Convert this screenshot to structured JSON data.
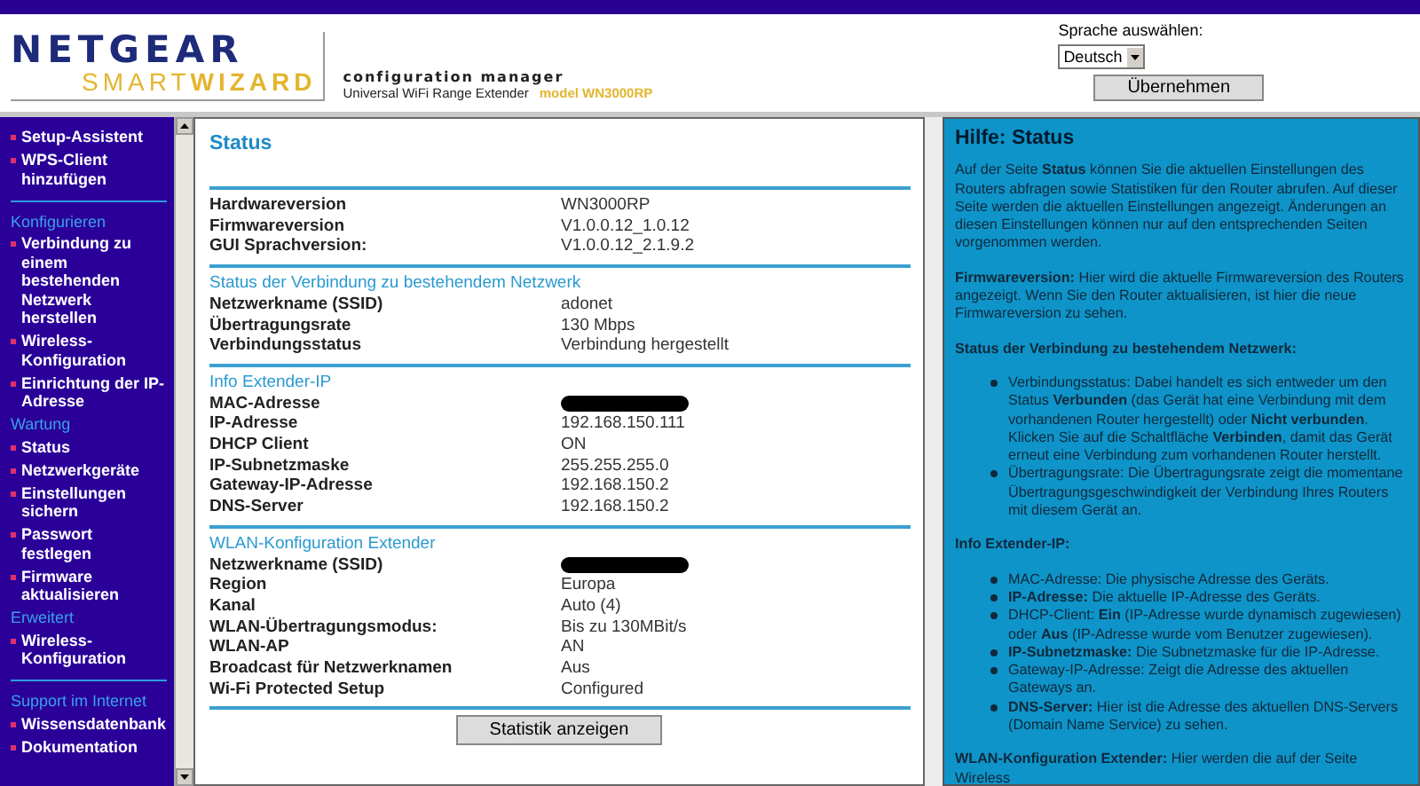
{
  "header": {
    "brand": "NETGEAR",
    "product_light": "SMART",
    "product_bold": "WIZARD",
    "tagline": "configuration manager",
    "product": "Universal WiFi Range Extender",
    "model": "model WN3000RP",
    "language_label": "Sprache auswählen:",
    "language_value": "Deutsch",
    "apply_button": "Übernehmen"
  },
  "sidebar": {
    "items": [
      {
        "kind": "link",
        "label": "Setup-Assistent"
      },
      {
        "kind": "link",
        "label": "WPS-Client hinzufügen"
      },
      {
        "kind": "divider"
      },
      {
        "kind": "heading",
        "label": "Konfigurieren"
      },
      {
        "kind": "link",
        "label": "Verbindung zu einem bestehenden Netzwerk herstellen"
      },
      {
        "kind": "link",
        "label": "Wireless-Konfiguration"
      },
      {
        "kind": "link",
        "label": "Einrichtung der IP-Adresse"
      },
      {
        "kind": "heading",
        "label": "Wartung"
      },
      {
        "kind": "link",
        "label": "Status"
      },
      {
        "kind": "link",
        "label": "Netzwerkgeräte"
      },
      {
        "kind": "link",
        "label": "Einstellungen sichern"
      },
      {
        "kind": "link",
        "label": "Passwort festlegen"
      },
      {
        "kind": "link",
        "label": "Firmware aktualisieren"
      },
      {
        "kind": "heading",
        "label": "Erweitert"
      },
      {
        "kind": "link",
        "label": "Wireless-Konfiguration"
      },
      {
        "kind": "divider"
      },
      {
        "kind": "heading",
        "label": "Support im Internet"
      },
      {
        "kind": "link",
        "label": "Wissensdatenbank"
      },
      {
        "kind": "link",
        "label": "Dokumentation"
      }
    ]
  },
  "main": {
    "title": "Status",
    "sections": [
      {
        "rows": [
          {
            "label": "Hardwareversion",
            "value": "WN3000RP"
          },
          {
            "label": "Firmwareversion",
            "value": "V1.0.0.12_1.0.12"
          },
          {
            "label": "GUI Sprachversion:",
            "value": "V1.0.0.12_2.1.9.2"
          }
        ]
      },
      {
        "heading": "Status der Verbindung zu bestehendem Netzwerk",
        "rows": [
          {
            "label": "Netzwerkname (SSID)",
            "value": "adonet"
          },
          {
            "label": "Übertragungsrate",
            "value": "130 Mbps"
          },
          {
            "label": "Verbindungsstatus",
            "value": "Verbindung hergestellt"
          }
        ]
      },
      {
        "heading": "Info Extender-IP",
        "rows": [
          {
            "label": "MAC-Adresse",
            "redacted": true
          },
          {
            "label": "IP-Adresse",
            "value": "192.168.150.111"
          },
          {
            "label": "DHCP Client",
            "value": "ON"
          },
          {
            "label": "IP-Subnetzmaske",
            "value": "255.255.255.0"
          },
          {
            "label": "Gateway-IP-Adresse",
            "value": "192.168.150.2"
          },
          {
            "label": "DNS-Server",
            "value": "192.168.150.2"
          }
        ]
      },
      {
        "heading": "WLAN-Konfiguration Extender",
        "rows": [
          {
            "label": "Netzwerkname (SSID)",
            "redacted": true
          },
          {
            "label": "Region",
            "value": "Europa"
          },
          {
            "label": "Kanal",
            "value": "Auto (4)"
          },
          {
            "label": "WLAN-Übertragungsmodus:",
            "value": "Bis zu 130MBit/s"
          },
          {
            "label": "WLAN-AP",
            "value": "AN"
          },
          {
            "label": "Broadcast für Netzwerknamen",
            "value": "Aus"
          },
          {
            "label": "Wi-Fi Protected Setup",
            "value": "Configured"
          }
        ]
      }
    ],
    "button": "Statistik anzeigen"
  },
  "help": {
    "title": "Hilfe: Status",
    "blocks": [
      {
        "kind": "paragraph",
        "text": "Auf der Seite **Status** können Sie die aktuellen Einstellungen des Routers abfragen sowie Statistiken für den Router abrufen. Auf dieser Seite werden die aktuellen Einstellungen angezeigt. Änderungen an diesen Einstellungen können nur auf den entsprechenden Seiten vorgenommen werden."
      },
      {
        "kind": "paragraph",
        "text": "**Firmwareversion:** Hier wird die aktuelle Firmwareversion des Routers angezeigt. Wenn Sie den Router aktualisieren, ist hier die neue Firmwareversion zu sehen."
      },
      {
        "kind": "heading",
        "text": "Status der Verbindung zu bestehendem Netzwerk:"
      },
      {
        "kind": "list",
        "items": [
          "Verbindungsstatus: Dabei handelt es sich entweder um den Status **Verbunden** (das Gerät hat eine Verbindung mit dem vorhandenen Router hergestellt) oder **Nicht verbunden**. Klicken Sie auf die Schaltfläche **Verbinden**, damit das Gerät erneut eine Verbindung zum vorhandenen Router herstellt.",
          "Übertragungsrate: Die Übertragungsrate zeigt die momentane Übertragungsgeschwindigkeit der Verbindung Ihres Routers mit diesem Gerät an."
        ]
      },
      {
        "kind": "heading",
        "text": "Info Extender-IP:"
      },
      {
        "kind": "list",
        "items": [
          "MAC-Adresse: Die physische Adresse des Geräts.",
          "**IP-Adresse:** Die aktuelle IP-Adresse des Geräts.",
          "DHCP-Client: **Ein** (IP-Adresse wurde dynamisch zugewiesen) oder **Aus** (IP-Adresse wurde vom Benutzer zugewiesen).",
          "**IP-Subnetzmaske:** Die Subnetzmaske für die IP-Adresse.",
          "Gateway-IP-Adresse: Zeigt die Adresse des aktuellen Gateways an.",
          "**DNS-Server:** Hier ist die Adresse des aktuellen DNS-Servers (Domain Name Service) zu sehen."
        ]
      },
      {
        "kind": "paragraph",
        "text": "**WLAN-Konfiguration Extender:** Hier werden die auf der Seite Wireless"
      }
    ]
  }
}
